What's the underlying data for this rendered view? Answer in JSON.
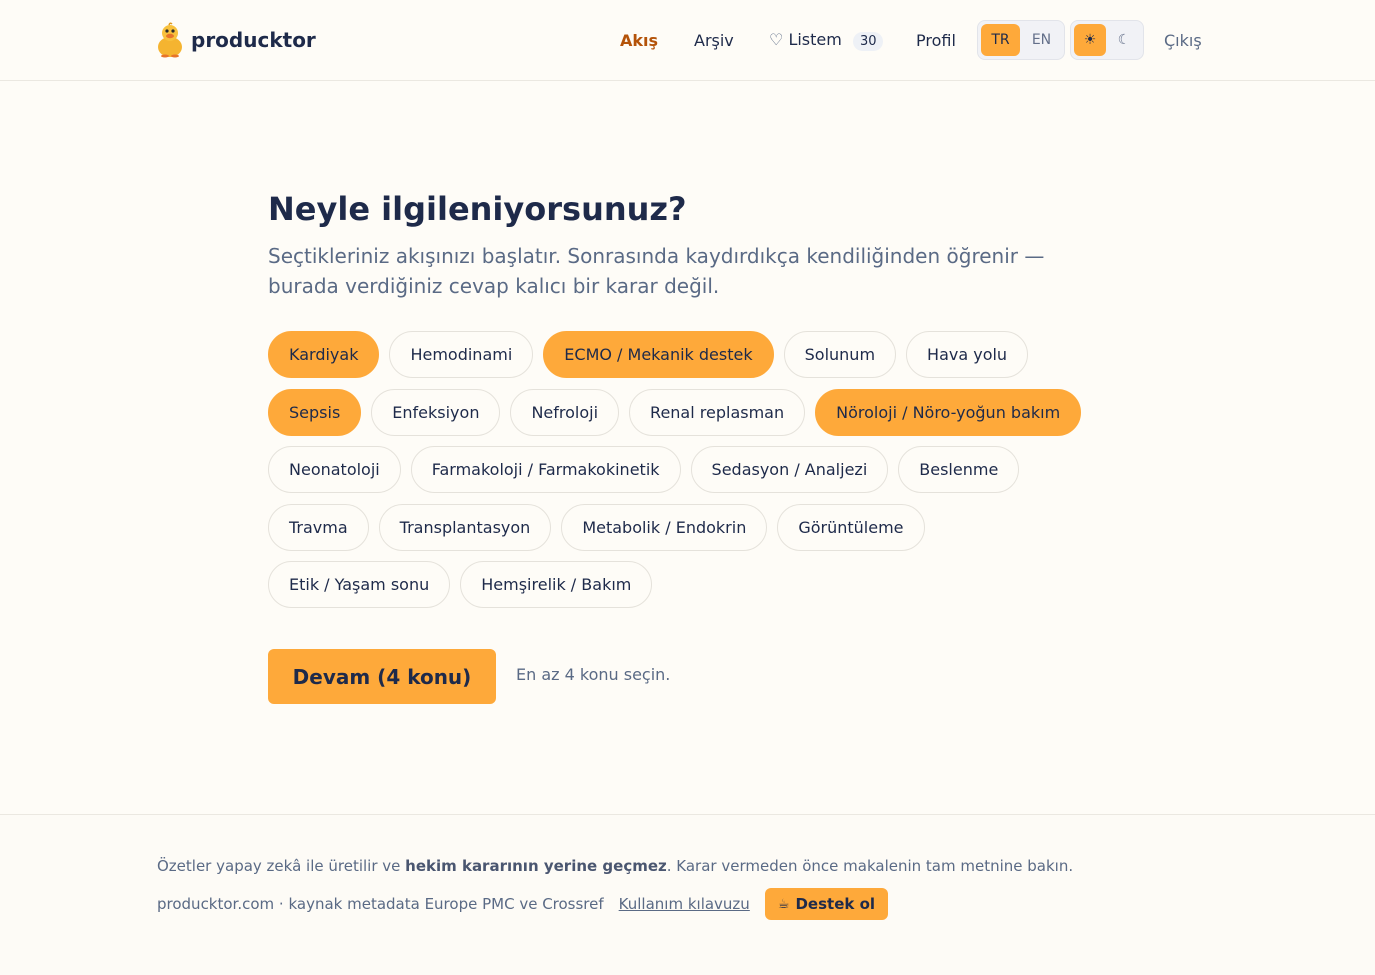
{
  "header": {
    "brand": "producktor",
    "nav": {
      "feed": "Akış",
      "archive": "Arşiv",
      "list_icon": "♡",
      "list_label": "Listem",
      "list_count": "30",
      "profile": "Profil",
      "logout": "Çıkış"
    },
    "lang": {
      "tr": "TR",
      "en": "EN",
      "selected": "TR"
    },
    "theme": {
      "light_icon": "☀",
      "dark_icon": "☾",
      "selected": "light"
    }
  },
  "main": {
    "title": "Neyle ilgileniyorsunuz?",
    "subtitle_line1": "Seçtikleriniz akışınızı başlatır. Sonrasında kaydırdıkça kendiliğinden öğrenir —",
    "subtitle_line2": "burada verdiğiniz cevap kalıcı bir karar değil.",
    "topic_rows": [
      [
        {
          "label": "Kardiyak",
          "selected": true
        },
        {
          "label": "Hemodinami",
          "selected": false
        },
        {
          "label": "ECMO / Mekanik destek",
          "selected": true
        },
        {
          "label": "Solunum",
          "selected": false
        },
        {
          "label": "Hava yolu",
          "selected": false
        }
      ],
      [
        {
          "label": "Sepsis",
          "selected": true
        },
        {
          "label": "Enfeksiyon",
          "selected": false
        },
        {
          "label": "Nefroloji",
          "selected": false
        },
        {
          "label": "Renal replasman",
          "selected": false
        },
        {
          "label": "Nöroloji / Nöro-yoğun bakım",
          "selected": true
        }
      ],
      [
        {
          "label": "Neonatoloji",
          "selected": false
        },
        {
          "label": "Farmakoloji / Farmakokinetik",
          "selected": false
        },
        {
          "label": "Sedasyon / Analjezi",
          "selected": false
        },
        {
          "label": "Beslenme",
          "selected": false
        }
      ],
      [
        {
          "label": "Travma",
          "selected": false
        },
        {
          "label": "Transplantasyon",
          "selected": false
        },
        {
          "label": "Metabolik / Endokrin",
          "selected": false
        },
        {
          "label": "Görüntüleme",
          "selected": false
        }
      ],
      [
        {
          "label": "Etik / Yaşam sonu",
          "selected": false
        },
        {
          "label": "Hemşirelik / Bakım",
          "selected": false
        }
      ]
    ],
    "continue_label": "Devam (4 konu)",
    "hint": "En az 4 konu seçin."
  },
  "footer": {
    "disclaimer_pre": "Özetler yapay zekâ ile üretilir ve ",
    "disclaimer_bold": "hekim kararının yerine geçmez",
    "disclaimer_post": ". Karar vermeden önce makalenin tam metnine bakın.",
    "source": "producktor.com · kaynak metadata Europe PMC ve Crossref",
    "guide_link": "Kullanım kılavuzu",
    "support_icon": "☕",
    "support_label": "Destek ol"
  },
  "colors": {
    "accent": "#fea93a",
    "active_nav": "#b45309",
    "text": "#1e2a4a",
    "muted": "#5a6a85",
    "background": "#fefcf7"
  }
}
